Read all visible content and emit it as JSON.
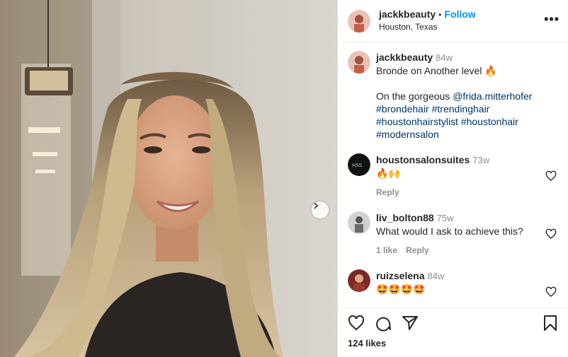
{
  "post": {
    "username": "jackkbeauty",
    "separator": "•",
    "follow_label": "Follow",
    "location": "Houston, Texas",
    "more_label": "•••"
  },
  "caption": {
    "username": "jackkbeauty",
    "time": "84w",
    "line1": "Bronde on Another level 🔥",
    "line2_prefix": "On the gorgeous ",
    "mention": "@frida.mitterhofer",
    "hashtags": [
      "#brondehair",
      "#trendinghair",
      "#houstonhairstylist",
      "#houstonhair",
      "#modernsalon"
    ]
  },
  "comments": [
    {
      "username": "houstonsalonsuites",
      "time": "73w",
      "text": "🔥🙌",
      "reply_label": "Reply"
    },
    {
      "username": "liv_bolton88",
      "time": "75w",
      "text": "What would I ask to achieve this?",
      "likes_label": "1 like",
      "reply_label": "Reply"
    },
    {
      "username": "ruizselena",
      "time": "84w",
      "text": "🤩🤩🤩🤩"
    }
  ],
  "footer": {
    "likes": "124 likes"
  },
  "icons": {
    "like": "heart-icon",
    "comment": "comment-icon",
    "share": "share-icon",
    "save": "bookmark-icon",
    "next": "chevron-right-icon"
  },
  "colors": {
    "follow": "#0095f6",
    "link": "#00376b",
    "muted": "#8e8e8e"
  }
}
